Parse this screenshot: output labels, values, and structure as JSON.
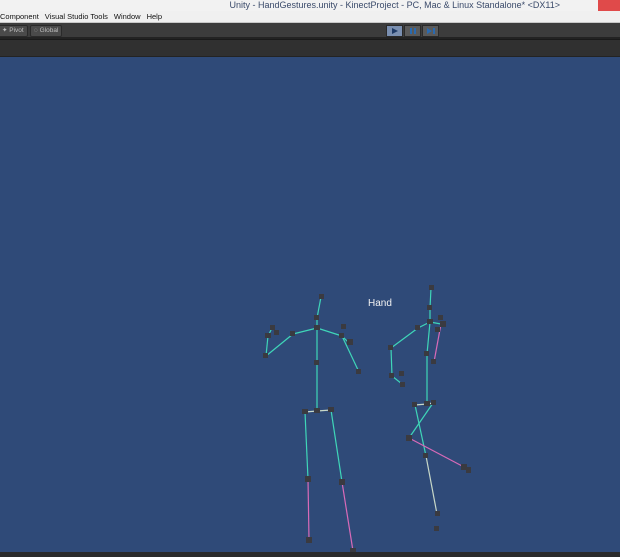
{
  "window": {
    "title": "Unity - HandGestures.unity - KinectProject - PC, Mac & Linux Standalone* <DX11>"
  },
  "menu": [
    "Component",
    "Visual Studio Tools",
    "Window",
    "Help"
  ],
  "toolbar": {
    "pivot_label": "Pivot",
    "global_label": "Global",
    "play_icons": [
      "play-icon",
      "pause-icon",
      "step-icon"
    ]
  },
  "scene": {
    "background": "#2f4a78",
    "label": "Hand"
  },
  "colors": {
    "bone_cyan": "#3fd6b8",
    "bone_pink": "#d86ab8",
    "bone_light": "#c8d8c8",
    "joint": "#3a3a40"
  }
}
